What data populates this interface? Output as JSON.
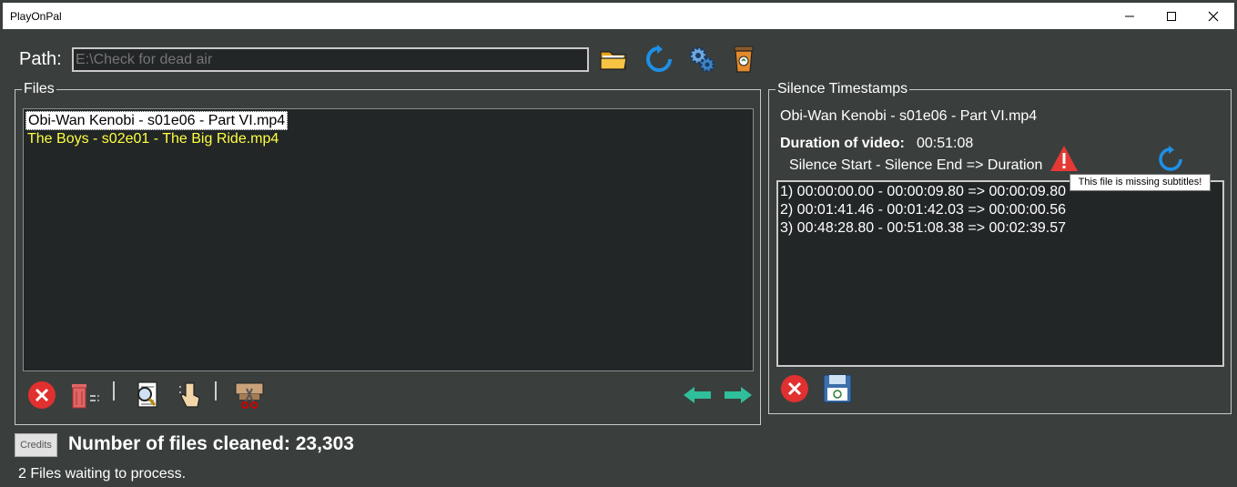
{
  "window": {
    "title": "PlayOnPal"
  },
  "path": {
    "label": "Path:",
    "placeholder": "E:\\Check for dead air"
  },
  "files": {
    "legend": "Files",
    "items": [
      {
        "name": "Obi-Wan Kenobi - s01e06 - Part VI.mp4"
      },
      {
        "name": "The Boys - s02e01 - The Big Ride.mp4"
      }
    ]
  },
  "timestamps": {
    "legend": "Silence Timestamps",
    "file_name": "Obi-Wan Kenobi - s01e06 - Part VI.mp4",
    "duration_label": "Duration of video:",
    "duration_value": "00:51:08",
    "header": "Silence Start - Silence End => Duration",
    "rows": [
      "1) 00:00:00.00 - 00:00:09.80 => 00:00:09.80",
      "2) 00:01:41.46 - 00:01:42.03 => 00:00:00.56",
      "3) 00:48:28.80 - 00:51:08.38 => 00:02:39.57"
    ],
    "tooltip": "This file is missing subtitles!"
  },
  "footer": {
    "credits_label": "Credits",
    "cleaned_label": "Number of files cleaned:",
    "cleaned_value": "23,303",
    "status": "2 Files waiting to process."
  },
  "colors": {
    "background": "#3a3f3d",
    "list_bg": "#222627",
    "pending_file": "#ffff40",
    "accent_blue": "#1e90e8",
    "red": "#e03030",
    "teal": "#2fbf9a"
  }
}
